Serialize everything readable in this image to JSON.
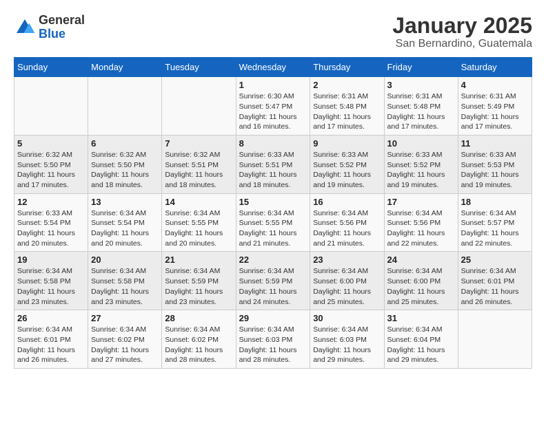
{
  "logo": {
    "general": "General",
    "blue": "Blue"
  },
  "title": "January 2025",
  "subtitle": "San Bernardino, Guatemala",
  "weekdays": [
    "Sunday",
    "Monday",
    "Tuesday",
    "Wednesday",
    "Thursday",
    "Friday",
    "Saturday"
  ],
  "weeks": [
    [
      {
        "day": "",
        "info": ""
      },
      {
        "day": "",
        "info": ""
      },
      {
        "day": "",
        "info": ""
      },
      {
        "day": "1",
        "info": "Sunrise: 6:30 AM\nSunset: 5:47 PM\nDaylight: 11 hours and 16 minutes."
      },
      {
        "day": "2",
        "info": "Sunrise: 6:31 AM\nSunset: 5:48 PM\nDaylight: 11 hours and 17 minutes."
      },
      {
        "day": "3",
        "info": "Sunrise: 6:31 AM\nSunset: 5:48 PM\nDaylight: 11 hours and 17 minutes."
      },
      {
        "day": "4",
        "info": "Sunrise: 6:31 AM\nSunset: 5:49 PM\nDaylight: 11 hours and 17 minutes."
      }
    ],
    [
      {
        "day": "5",
        "info": "Sunrise: 6:32 AM\nSunset: 5:50 PM\nDaylight: 11 hours and 17 minutes."
      },
      {
        "day": "6",
        "info": "Sunrise: 6:32 AM\nSunset: 5:50 PM\nDaylight: 11 hours and 18 minutes."
      },
      {
        "day": "7",
        "info": "Sunrise: 6:32 AM\nSunset: 5:51 PM\nDaylight: 11 hours and 18 minutes."
      },
      {
        "day": "8",
        "info": "Sunrise: 6:33 AM\nSunset: 5:51 PM\nDaylight: 11 hours and 18 minutes."
      },
      {
        "day": "9",
        "info": "Sunrise: 6:33 AM\nSunset: 5:52 PM\nDaylight: 11 hours and 19 minutes."
      },
      {
        "day": "10",
        "info": "Sunrise: 6:33 AM\nSunset: 5:52 PM\nDaylight: 11 hours and 19 minutes."
      },
      {
        "day": "11",
        "info": "Sunrise: 6:33 AM\nSunset: 5:53 PM\nDaylight: 11 hours and 19 minutes."
      }
    ],
    [
      {
        "day": "12",
        "info": "Sunrise: 6:33 AM\nSunset: 5:54 PM\nDaylight: 11 hours and 20 minutes."
      },
      {
        "day": "13",
        "info": "Sunrise: 6:34 AM\nSunset: 5:54 PM\nDaylight: 11 hours and 20 minutes."
      },
      {
        "day": "14",
        "info": "Sunrise: 6:34 AM\nSunset: 5:55 PM\nDaylight: 11 hours and 20 minutes."
      },
      {
        "day": "15",
        "info": "Sunrise: 6:34 AM\nSunset: 5:55 PM\nDaylight: 11 hours and 21 minutes."
      },
      {
        "day": "16",
        "info": "Sunrise: 6:34 AM\nSunset: 5:56 PM\nDaylight: 11 hours and 21 minutes."
      },
      {
        "day": "17",
        "info": "Sunrise: 6:34 AM\nSunset: 5:56 PM\nDaylight: 11 hours and 22 minutes."
      },
      {
        "day": "18",
        "info": "Sunrise: 6:34 AM\nSunset: 5:57 PM\nDaylight: 11 hours and 22 minutes."
      }
    ],
    [
      {
        "day": "19",
        "info": "Sunrise: 6:34 AM\nSunset: 5:58 PM\nDaylight: 11 hours and 23 minutes."
      },
      {
        "day": "20",
        "info": "Sunrise: 6:34 AM\nSunset: 5:58 PM\nDaylight: 11 hours and 23 minutes."
      },
      {
        "day": "21",
        "info": "Sunrise: 6:34 AM\nSunset: 5:59 PM\nDaylight: 11 hours and 23 minutes."
      },
      {
        "day": "22",
        "info": "Sunrise: 6:34 AM\nSunset: 5:59 PM\nDaylight: 11 hours and 24 minutes."
      },
      {
        "day": "23",
        "info": "Sunrise: 6:34 AM\nSunset: 6:00 PM\nDaylight: 11 hours and 25 minutes."
      },
      {
        "day": "24",
        "info": "Sunrise: 6:34 AM\nSunset: 6:00 PM\nDaylight: 11 hours and 25 minutes."
      },
      {
        "day": "25",
        "info": "Sunrise: 6:34 AM\nSunset: 6:01 PM\nDaylight: 11 hours and 26 minutes."
      }
    ],
    [
      {
        "day": "26",
        "info": "Sunrise: 6:34 AM\nSunset: 6:01 PM\nDaylight: 11 hours and 26 minutes."
      },
      {
        "day": "27",
        "info": "Sunrise: 6:34 AM\nSunset: 6:02 PM\nDaylight: 11 hours and 27 minutes."
      },
      {
        "day": "28",
        "info": "Sunrise: 6:34 AM\nSunset: 6:02 PM\nDaylight: 11 hours and 28 minutes."
      },
      {
        "day": "29",
        "info": "Sunrise: 6:34 AM\nSunset: 6:03 PM\nDaylight: 11 hours and 28 minutes."
      },
      {
        "day": "30",
        "info": "Sunrise: 6:34 AM\nSunset: 6:03 PM\nDaylight: 11 hours and 29 minutes."
      },
      {
        "day": "31",
        "info": "Sunrise: 6:34 AM\nSunset: 6:04 PM\nDaylight: 11 hours and 29 minutes."
      },
      {
        "day": "",
        "info": ""
      }
    ]
  ]
}
